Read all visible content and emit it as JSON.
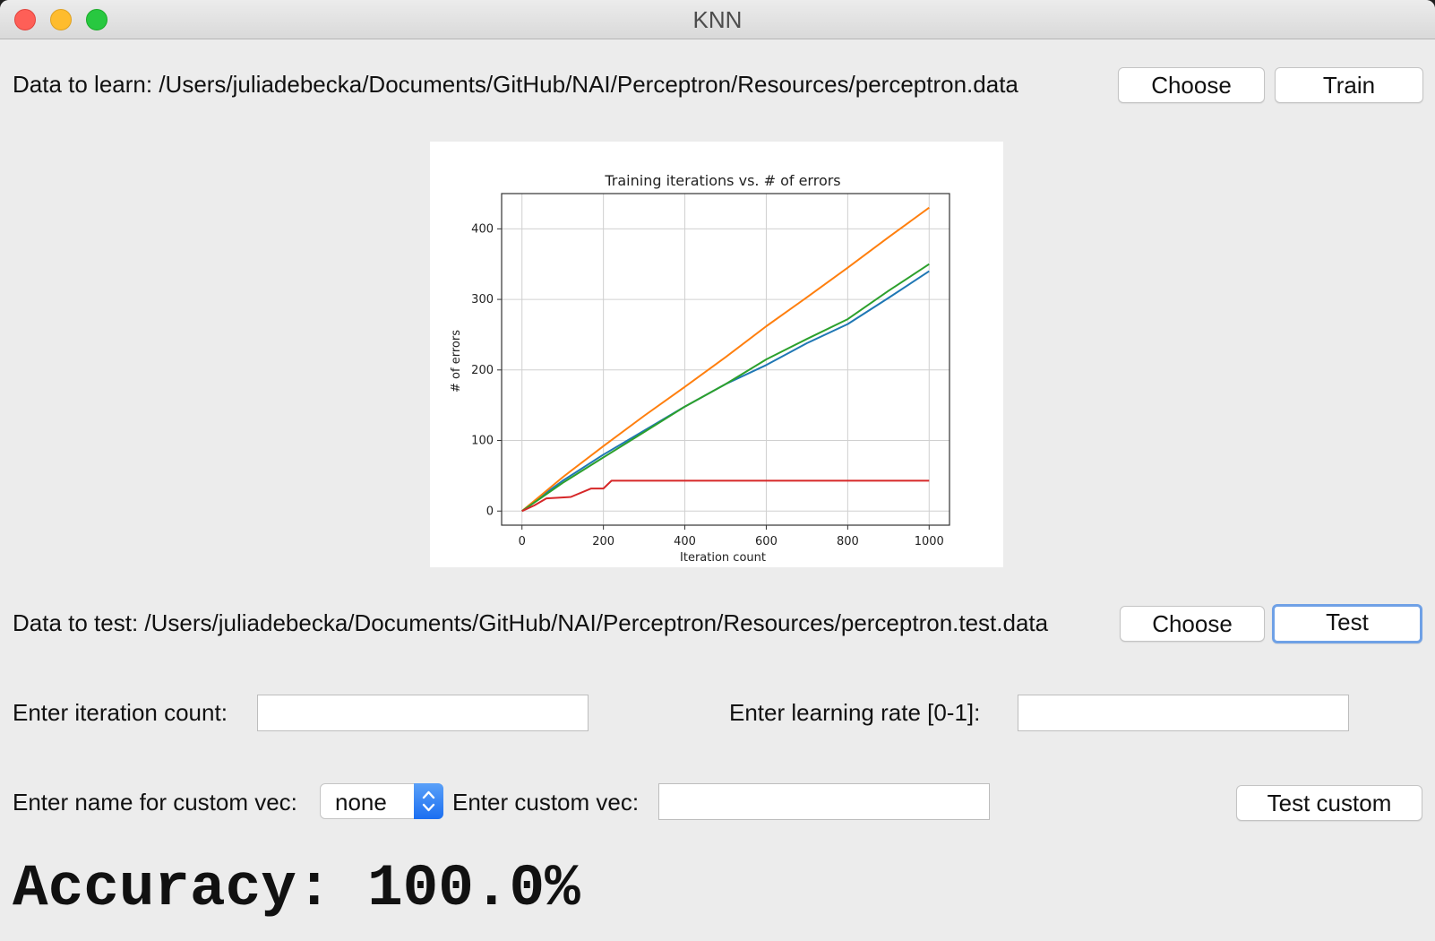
{
  "window": {
    "title": "KNN"
  },
  "train_row": {
    "label": "Data to learn: /Users/juliadebecka/Documents/GitHub/NAI/Perceptron/Resources/perceptron.data",
    "choose_label": "Choose",
    "train_label": "Train"
  },
  "test_row": {
    "label": "Data to test: /Users/juliadebecka/Documents/GitHub/NAI/Perceptron/Resources/perceptron.test.data",
    "choose_label": "Choose",
    "test_label": "Test"
  },
  "params": {
    "iteration_label": "Enter iteration count:",
    "iteration_value": "",
    "rate_label": "Enter learning rate [0-1]:",
    "rate_value": ""
  },
  "custom": {
    "name_label": "Enter name for custom vec:",
    "name_selected": "none",
    "vec_label": "Enter custom vec:",
    "vec_value": "",
    "test_custom_label": "Test custom"
  },
  "result": {
    "accuracy_text": "Accuracy: 100.0%"
  },
  "chart_data": {
    "type": "line",
    "title": "Training iterations vs. # of errors",
    "xlabel": "Iteration count",
    "ylabel": "# of errors",
    "xlim": [
      -50,
      1050
    ],
    "ylim": [
      -20,
      450
    ],
    "xticks": [
      0,
      200,
      400,
      600,
      800,
      1000
    ],
    "yticks": [
      0,
      100,
      200,
      300,
      400
    ],
    "grid": true,
    "series": [
      {
        "color": "#1f77b4",
        "x": [
          0,
          50,
          100,
          200,
          300,
          400,
          500,
          600,
          700,
          800,
          900,
          1000
        ],
        "y": [
          0,
          22,
          43,
          80,
          114,
          148,
          180,
          207,
          238,
          265,
          302,
          340
        ]
      },
      {
        "color": "#ff7f0e",
        "x": [
          0,
          50,
          100,
          200,
          300,
          400,
          500,
          600,
          700,
          800,
          900,
          1000
        ],
        "y": [
          0,
          24,
          48,
          92,
          135,
          176,
          218,
          262,
          303,
          345,
          388,
          430
        ]
      },
      {
        "color": "#2ca02c",
        "x": [
          0,
          50,
          100,
          200,
          300,
          400,
          500,
          600,
          700,
          800,
          900,
          1000
        ],
        "y": [
          0,
          20,
          40,
          76,
          112,
          148,
          180,
          215,
          244,
          272,
          312,
          350
        ]
      },
      {
        "color": "#d62728",
        "x": [
          0,
          30,
          60,
          120,
          170,
          200,
          220,
          1000
        ],
        "y": [
          0,
          8,
          18,
          20,
          32,
          32,
          43,
          43
        ]
      }
    ]
  }
}
